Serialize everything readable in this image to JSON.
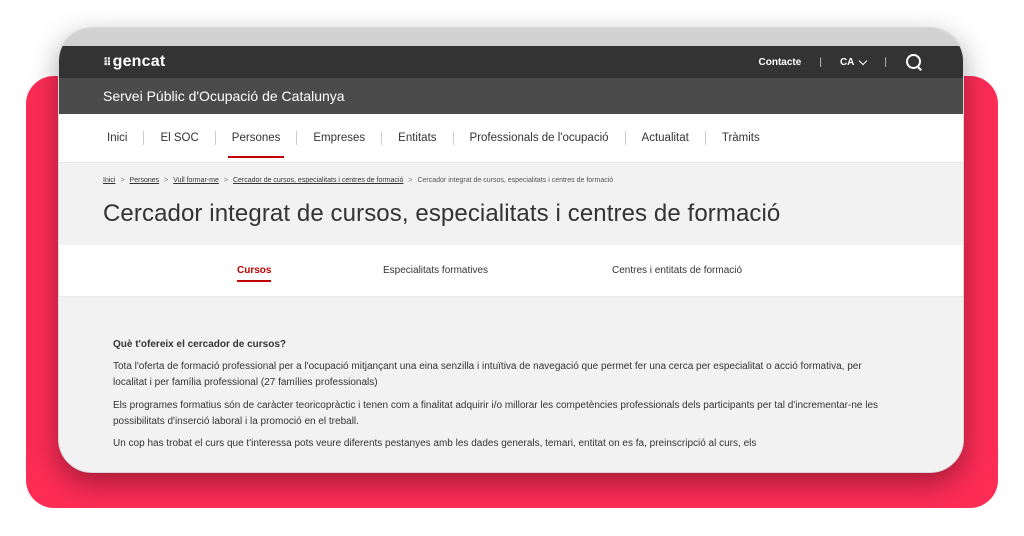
{
  "gencat": {
    "logo_mark": "⠿",
    "logo_text": "gencat",
    "contact_label": "Contacte",
    "separator": "|",
    "language": "CA"
  },
  "soc": {
    "title": "Servei Públic d'Ocupació de Catalunya"
  },
  "nav": {
    "items": [
      {
        "label": "Inici"
      },
      {
        "label": "El SOC"
      },
      {
        "label": "Persones"
      },
      {
        "label": "Empreses"
      },
      {
        "label": "Entitats"
      },
      {
        "label": "Professionals de l'ocupació"
      },
      {
        "label": "Actualitat"
      },
      {
        "label": "Tràmits"
      }
    ],
    "active": "Persones"
  },
  "breadcrumb": {
    "items": [
      {
        "label": "Inici"
      },
      {
        "label": "Persones"
      },
      {
        "label": "Vull formar-me"
      },
      {
        "label": "Cercador de cursos, especialitats i centres de formació"
      },
      {
        "label": "Cercador integrat de cursos, especialitats i centres de formació"
      }
    ],
    "separator": ">"
  },
  "page": {
    "title": "Cercador integrat de cursos, especialitats i centres de formació"
  },
  "tabs": {
    "items": [
      {
        "label": "Cursos"
      },
      {
        "label": "Especialitats formatives"
      },
      {
        "label": "Centres i entitats de formació"
      }
    ],
    "active": "Cursos"
  },
  "content": {
    "heading": "Què t'ofereix el cercador de cursos?",
    "paragraphs": [
      "Tota l'oferta de formació professional per a l'ocupació mitjançant una eina senzilla i intuïtiva de navegació que permet fer una cerca per especialitat o acció formativa, per localitat i per família professional (27 famílies professionals)",
      "Els programes formatius són de caràcter teoricopràctic i tenen com a finalitat adquirir i/o millorar les competències professionals dels participants per tal d'incrementar-ne les possibilitats d'inserció laboral i la promoció en el treball.",
      "Un cop has trobat el curs que t'interessa pots veure diferents pestanyes amb les dades generals, temari, entitat on es fa, preinscripció al curs, els"
    ]
  },
  "colors": {
    "accent": "#c00000",
    "pink_background": "#fc2c55",
    "gencat_bar": "#333333",
    "soc_bar": "#4b4b4b"
  }
}
